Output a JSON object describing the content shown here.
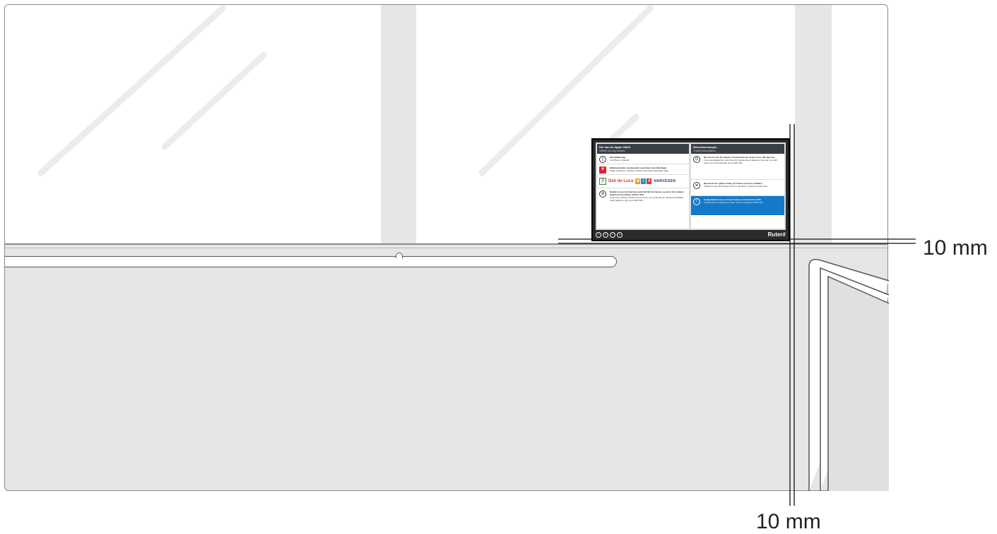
{
  "dimensions": {
    "vertical_label": "10 mm",
    "horizontal_label": "10 mm"
  },
  "poster": {
    "left": {
      "title": "Her kan du kjøpe billett",
      "subtitle": "Where to buy tickets",
      "app_title": "RuterBillett app",
      "app_sub": "For iPhone / Android",
      "ticket_icon": "#",
      "machine_title": "Billettautomater, kundesenter og kiosker med billettsalg",
      "machine_sub": "Ticket machines, customer centres and kiosks with ticket sales",
      "logo_7eleven": "7",
      "logo_deli": "Deli de Luca",
      "logo_mix": [
        "M",
        "I",
        "X"
      ],
      "logo_narvesen": "NARVESEN",
      "onboard_title": "Betaler du om bord på buss eller båt blir det dyrere, og det er kun mulig å betale med kontanter inntil kr 500.",
      "onboard_sub": "If you buy a ticket on board a bus or ferry, you must pay an onboard surcharge. Cash payment only, up to 500 NOK."
    },
    "right": {
      "title": "Reiseinformasjon",
      "subtitle": "Travel information",
      "delay_title": "Blir du mer enn 20 minutter forsinket kan du ta taxi, buss, båt eller tog.",
      "delay_sub": "If you are delayed for more than 20 minutes due to delays on our part, you will cover your taxi expenses up to NOK 750.",
      "bike_title": "Barnesete for sykkel: Gratis på T-banen utenom rushtiden",
      "bike_sub": "Children's free for bicycles. Free on the Metro, except at peak times.",
      "notice_icon": "!",
      "notice_title": "Gyldig billett kreves om bord. Gebyr ved kontroll kr 1150.",
      "notice_sub": "A valid ticket is required on board. Fine at inspection 1150 NOK."
    },
    "footer_icons": [
      "T",
      "B",
      "F",
      "S"
    ],
    "brand": "Ruter#"
  },
  "colors": {
    "panel": "#e6e6e5",
    "poster_head": "#3a3f47",
    "ruter_red": "#e3202c",
    "notice_blue": "#1479c9"
  }
}
